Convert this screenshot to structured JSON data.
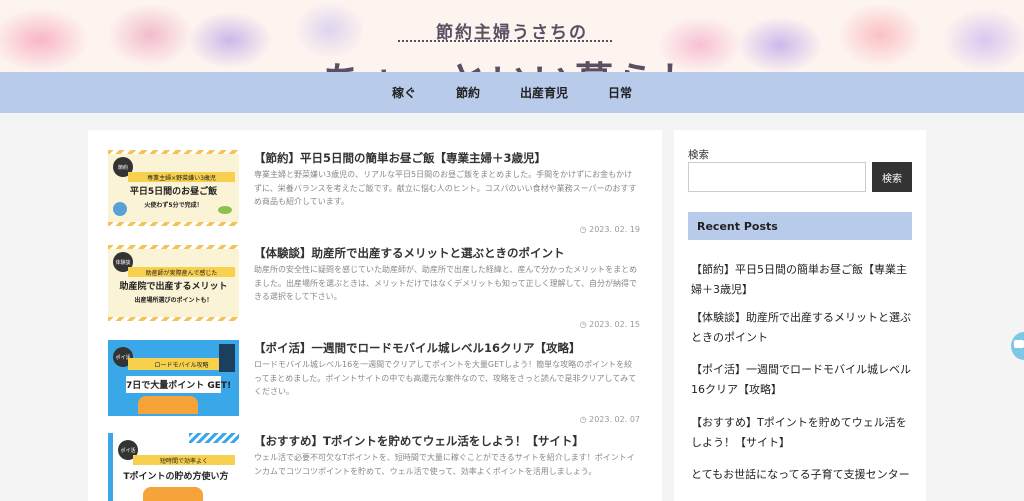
{
  "header": {
    "subtitle": "節約主婦うさちの",
    "title": "ちょっといい暮らし"
  },
  "nav": {
    "items": [
      "稼ぐ",
      "節約",
      "出産育児",
      "日常"
    ]
  },
  "posts": [
    {
      "title": "【節約】平日5日間の簡単お昼ご飯【専業主婦＋3歳児】",
      "excerpt": "専業主婦と野菜嫌い3歳児の、リアルな平日5日間のお昼ご飯をまとめました。手間をかけずにお金もかけずに、栄養バランスを考えたご飯です。献立に悩む人のヒント。コスパのいい食材や業務スーパーのおすすめ商品も紹介しています。",
      "date": "2023. 02. 19",
      "thumb": {
        "tag": "節約",
        "band": "専業主婦×野菜嫌い3歳児",
        "title": "平日5日間のお昼ご飯",
        "sub": "火使わず5分で完成！",
        "bg": "#fbf3d5"
      }
    },
    {
      "title": "【体験談】助産所で出産するメリットと選ぶときのポイント",
      "excerpt": "助産所の安全性に疑問を感じていた助産師が、助産所で出産した経緯と、産んで分かったメリットをまとめました。出産場所を選ぶときは、メリットだけではなくデメリットも知って正しく理解して、自分が納得できる選択をして下さい。",
      "date": "2023. 02. 15",
      "thumb": {
        "tag": "体験談",
        "band": "助産師が実際産んで感じた",
        "title": "助産院で出産するメリット",
        "sub": "出産場所選びのポイントも！",
        "bg": "#fbf3d5"
      }
    },
    {
      "title": "【ポイ活】一週間でロードモバイル城レベル16クリア【攻略】",
      "excerpt": "ロードモバイル城レベル16を一週間でクリアしてポイントを大量GETしよう！簡単な攻略のポイントを絞ってまとめました。ポイントサイトの中でも高還元な案件なので、攻略をさっと読んで是非クリアしてみてください。",
      "date": "2023. 02. 07",
      "thumb": {
        "tag": "ポイ活",
        "band": "ロードモバイル攻略",
        "title": "7日で大量ポイント GET!",
        "sub": "",
        "bg": "#3aa8e8"
      }
    },
    {
      "title": "【おすすめ】Tポイントを貯めてウェル活をしよう！【サイト】",
      "excerpt": "ウェル活で必要不可欠なTポイントを、短時間で大量に稼ぐことができるサイトを紹介します！ポイントインカムでコツコツポイントを貯めて、ウェル活で使って、効率よくポイントを活用しましょう。",
      "date": "",
      "thumb": {
        "tag": "ポイ活",
        "band": "短時間で効率よく",
        "title": "Tポイントの貯め方使い方",
        "sub": "",
        "bg": "#ffffff"
      }
    }
  ],
  "sidebar": {
    "search_label": "検索",
    "search_placeholder": "",
    "search_button": "検索",
    "recent_heading": "Recent Posts",
    "recent": [
      "【節約】平日5日間の簡単お昼ご飯【専業主婦＋3歳児】",
      "【体験談】助産所で出産するメリットと選ぶときのポイント",
      "【ポイ活】一週間でロードモバイル城レベル16クリア【攻略】",
      "【おすすめ】Tポイントを貯めてウェル活をしよう！【サイト】",
      "とてもお世話になってる子育て支援センター"
    ]
  },
  "colors": {
    "nav": "#b8cbea",
    "header_bg": "#fdf3ef",
    "text": "#333333",
    "button": "#333333"
  },
  "icons": {
    "date": "clock-icon",
    "chat": "chat-icon"
  }
}
